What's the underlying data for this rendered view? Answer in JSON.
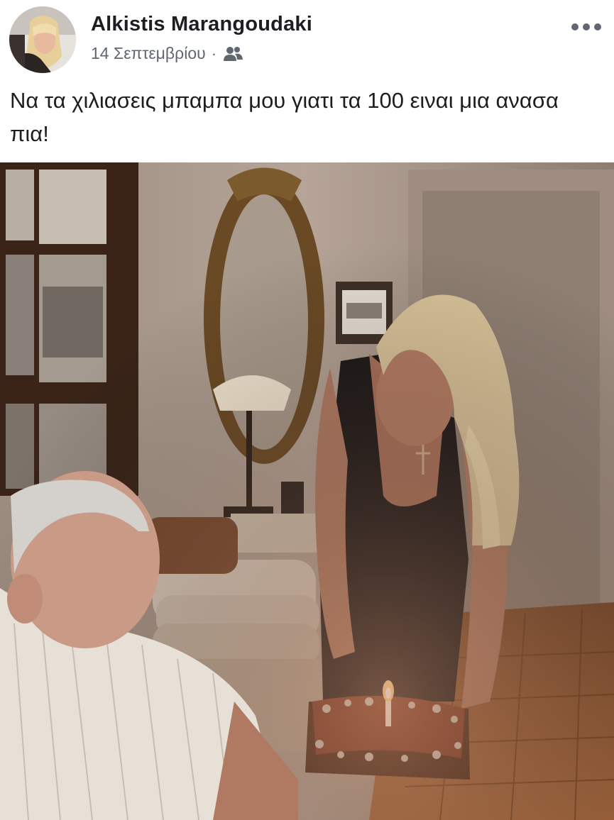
{
  "post": {
    "author_name": "Alkistis Marangoudaki",
    "date": "14 Σεπτεμβρίου",
    "separator": "·",
    "audience_icon": "friends-icon",
    "more_icon": "more-options-icon",
    "caption": "Να τα χιλιασεις μπαμπα μου γιατι τα 100 ειναι μια ανασα πια!"
  }
}
